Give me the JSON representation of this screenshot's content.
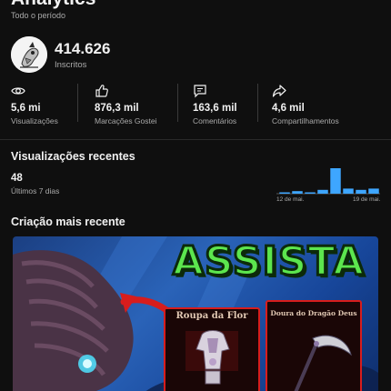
{
  "header": {
    "title": "Analytics",
    "period": "Todo o período"
  },
  "channel": {
    "subscribers": "414.626",
    "subscribers_label": "Inscritos"
  },
  "stats": [
    {
      "icon": "eye-icon",
      "value": "5,6 mi",
      "label": "Visualizações"
    },
    {
      "icon": "thumbs-up-icon",
      "value": "876,3 mil",
      "label": "Marcações Gostei"
    },
    {
      "icon": "comment-icon",
      "value": "163,6 mil",
      "label": "Comentários"
    },
    {
      "icon": "share-icon",
      "value": "4,6 mil",
      "label": "Compartilhamentos"
    }
  ],
  "recent_views": {
    "title": "Visualizações recentes",
    "count": "48",
    "period": "Últimos 7 dias",
    "x_labels": [
      "12 de mai.",
      "19 de mai."
    ]
  },
  "chart_data": {
    "type": "bar",
    "values": [
      1,
      2,
      1,
      3,
      20,
      4,
      3,
      4
    ],
    "color": "#3ea6ff",
    "tick_labels": [
      "12 de mai.",
      "19 de mai."
    ]
  },
  "latest": {
    "title": "Criação mais recente",
    "thumbnail_headline": "ASSISTA",
    "card_left_title": "Roupa da Flor",
    "card_right_title": "Doura do Dragão Deus"
  },
  "colors": {
    "background": "#0f0f0f",
    "accent": "#3ea6ff",
    "headline_green": "#5ce64e",
    "arrow_red": "#d71d1d"
  }
}
